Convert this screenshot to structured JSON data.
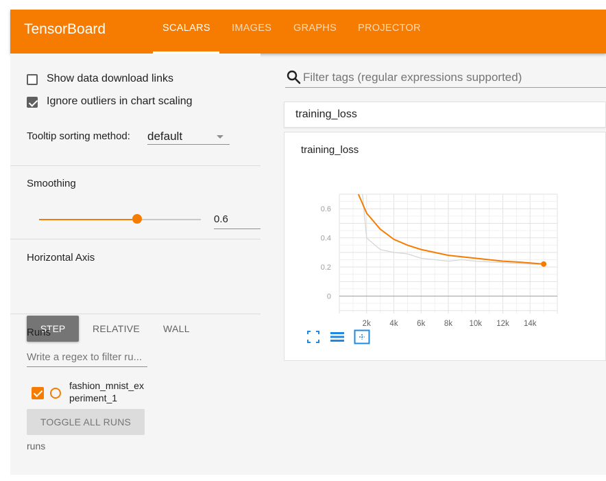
{
  "app": {
    "brand": "TensorBoard",
    "accent": "#f57c00"
  },
  "nav": {
    "tabs": [
      {
        "label": "SCALARS",
        "active": true
      },
      {
        "label": "IMAGES",
        "active": false
      },
      {
        "label": "GRAPHS",
        "active": false
      },
      {
        "label": "PROJECTOR",
        "active": false
      }
    ]
  },
  "sidebar": {
    "show_download": {
      "label": "Show data download links",
      "checked": false
    },
    "ignore_outliers": {
      "label": "Ignore outliers in chart scaling",
      "checked": true
    },
    "tooltip": {
      "label": "Tooltip sorting method:",
      "value": "default"
    },
    "smoothing": {
      "label": "Smoothing",
      "value": "0.6",
      "level": 0.6
    },
    "horizontal_axis": {
      "label": "Horizontal Axis",
      "options": [
        "STEP",
        "RELATIVE",
        "WALL"
      ],
      "selected": "STEP"
    },
    "runs": {
      "label": "Runs",
      "filter_placeholder": "Write a regex to filter ru...",
      "items": [
        {
          "name_line1": "fashion_mnist_ex",
          "name_line2": "periment_1",
          "checked": true,
          "color": "#f57c00"
        }
      ],
      "toggle_label": "TOGGLE ALL RUNS",
      "footer": "runs"
    }
  },
  "main": {
    "search_placeholder": "Filter tags (regular expressions supported)",
    "category": "training_loss",
    "card_title": "training_loss"
  },
  "chart_data": {
    "type": "line",
    "title": "training_loss",
    "xlabel": "",
    "ylabel": "",
    "xlim": [
      0,
      16000
    ],
    "ylim": [
      -0.12,
      0.7
    ],
    "x_ticks": [
      2000,
      4000,
      6000,
      8000,
      10000,
      12000,
      14000
    ],
    "x_tick_labels": [
      "2k",
      "4k",
      "6k",
      "8k",
      "10k",
      "12k",
      "14k"
    ],
    "y_ticks": [
      0,
      0.2,
      0.4,
      0.6
    ],
    "y_tick_labels": [
      "0",
      "0.2",
      "0.4",
      "0.6"
    ],
    "grid": true,
    "series": [
      {
        "role": "smoothed",
        "color": "#f57c00",
        "x": [
          1400,
          2000,
          3000,
          4000,
          5000,
          6000,
          7000,
          8000,
          9000,
          10000,
          11000,
          12000,
          13000,
          14000,
          15000
        ],
        "values": [
          0.7,
          0.57,
          0.46,
          0.39,
          0.35,
          0.32,
          0.3,
          0.28,
          0.27,
          0.26,
          0.25,
          0.24,
          0.235,
          0.228,
          0.22
        ]
      },
      {
        "role": "raw",
        "color": "#d6d6d6",
        "x": [
          1700,
          2000,
          3000,
          4000,
          5000,
          6000,
          7000,
          8000,
          9000,
          10000,
          11000,
          12000,
          13000,
          14000,
          15000
        ],
        "values": [
          0.7,
          0.4,
          0.32,
          0.3,
          0.29,
          0.26,
          0.25,
          0.24,
          0.25,
          0.24,
          0.235,
          0.23,
          0.225,
          0.22,
          0.22
        ]
      }
    ]
  }
}
